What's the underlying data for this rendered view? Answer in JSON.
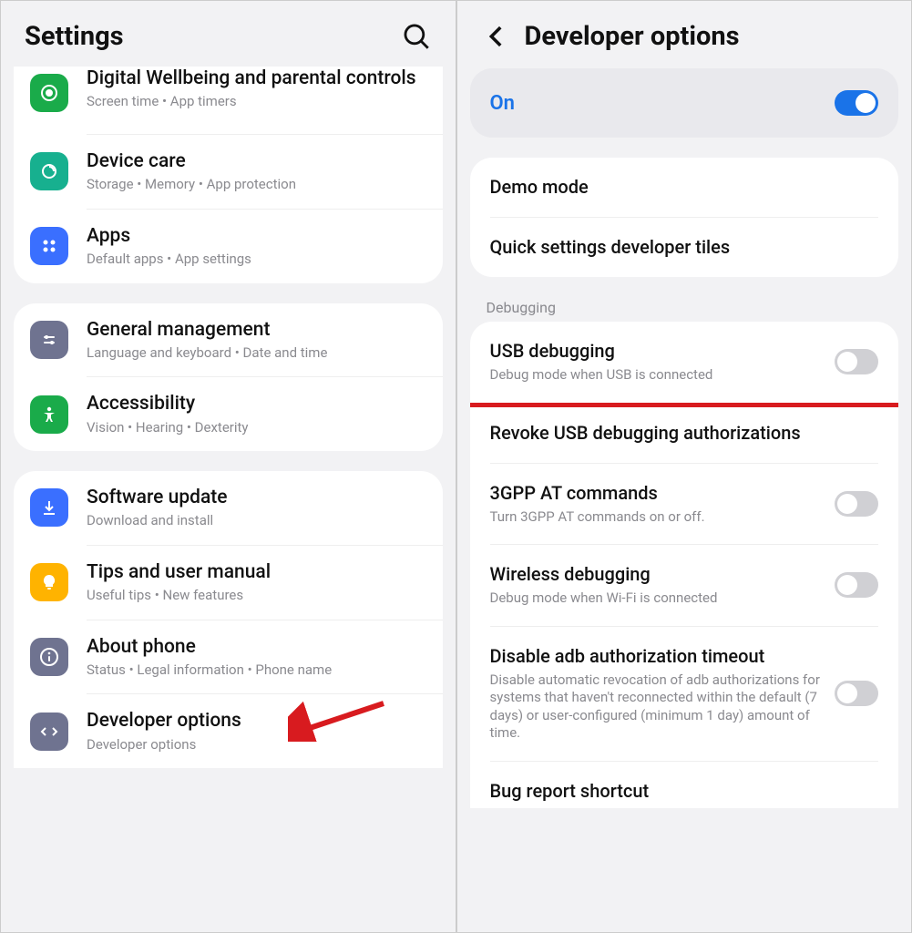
{
  "left": {
    "title": "Settings",
    "groups": [
      {
        "items": [
          {
            "id": "wellbeing",
            "title": "Digital Wellbeing and parental controls",
            "sub": "Screen time  •  App timers",
            "color": "#1aab4a"
          },
          {
            "id": "devicecare",
            "title": "Device care",
            "sub": "Storage  •  Memory  •  App protection",
            "color": "#17b08f"
          },
          {
            "id": "apps",
            "title": "Apps",
            "sub": "Default apps  •  App settings",
            "color": "#3a6fff"
          }
        ]
      },
      {
        "items": [
          {
            "id": "general",
            "title": "General management",
            "sub": "Language and keyboard  •  Date and time",
            "color": "#6f7390"
          },
          {
            "id": "accessibility",
            "title": "Accessibility",
            "sub": "Vision  •  Hearing  •  Dexterity",
            "color": "#1aab4a"
          }
        ]
      },
      {
        "items": [
          {
            "id": "software",
            "title": "Software update",
            "sub": "Download and install",
            "color": "#3a6fff"
          },
          {
            "id": "tips",
            "title": "Tips and user manual",
            "sub": "Useful tips  •  New features",
            "color": "#ffb300"
          },
          {
            "id": "about",
            "title": "About phone",
            "sub": "Status  •  Legal information  •  Phone name",
            "color": "#6f7390"
          },
          {
            "id": "developer",
            "title": "Developer options",
            "sub": "Developer options",
            "color": "#6f7390"
          }
        ]
      }
    ]
  },
  "right": {
    "title": "Developer options",
    "master_toggle_label": "On",
    "master_toggle_on": true,
    "group1": [
      {
        "id": "demo",
        "title": "Demo mode"
      },
      {
        "id": "qstiles",
        "title": "Quick settings developer tiles"
      }
    ],
    "debug_label": "Debugging",
    "debug_items": [
      {
        "id": "usb",
        "title": "USB debugging",
        "sub": "Debug mode when USB is connected",
        "toggle": false,
        "hl": true
      },
      {
        "id": "revoke",
        "title": "Revoke USB debugging authorizations"
      },
      {
        "id": "3gpp",
        "title": "3GPP AT commands",
        "sub": "Turn 3GPP AT commands on or off.",
        "toggle": false
      },
      {
        "id": "wireless",
        "title": "Wireless debugging",
        "sub": "Debug mode when Wi-Fi is connected",
        "toggle": false
      },
      {
        "id": "adbto",
        "title": "Disable adb authorization timeout",
        "sub": "Disable automatic revocation of adb authorizations for systems that haven't reconnected within the default (7 days) or user-configured (minimum 1 day) amount of time.",
        "toggle": false
      },
      {
        "id": "bugreport",
        "title": "Bug report shortcut"
      }
    ]
  }
}
